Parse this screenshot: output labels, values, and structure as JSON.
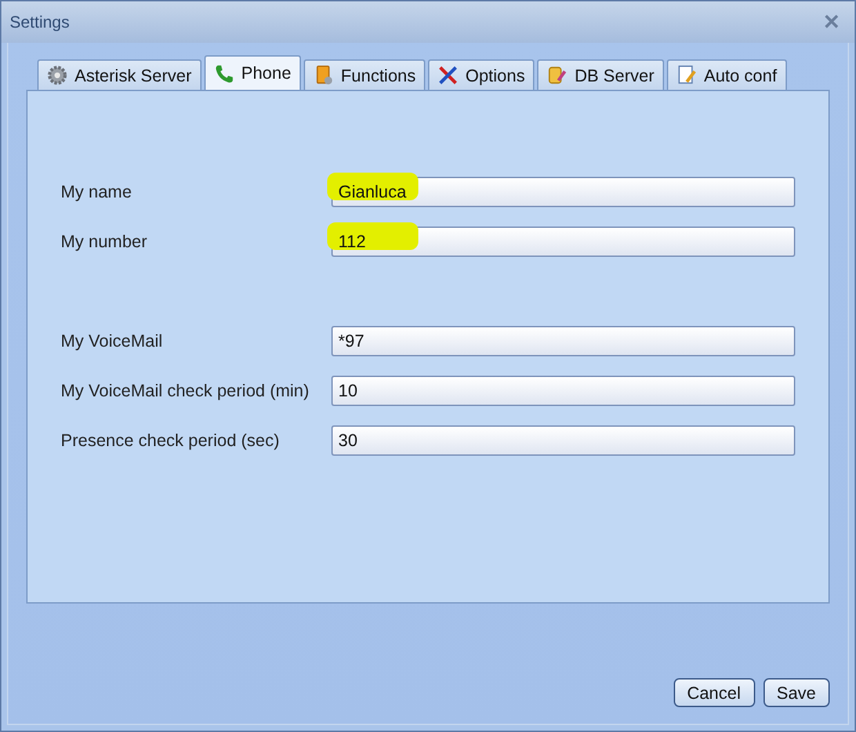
{
  "window": {
    "title": "Settings",
    "close": "✕"
  },
  "tabs": [
    {
      "label": "Asterisk Server",
      "selected": false
    },
    {
      "label": "Phone",
      "selected": true
    },
    {
      "label": "Functions",
      "selected": false
    },
    {
      "label": "Options",
      "selected": false
    },
    {
      "label": "DB Server",
      "selected": false
    },
    {
      "label": "Auto conf",
      "selected": false
    }
  ],
  "field_groups": [
    [
      {
        "label": "My name",
        "value": "Gianluca",
        "highlighted": true
      },
      {
        "label": "My number",
        "value": "112",
        "highlighted": true
      }
    ],
    [
      {
        "label": "My VoiceMail",
        "value": "*97",
        "highlighted": false
      },
      {
        "label": "My VoiceMail check period (min)",
        "value": "10",
        "highlighted": false
      },
      {
        "label": "Presence check period (sec)",
        "value": "30",
        "highlighted": false
      }
    ]
  ],
  "buttons": [
    "Cancel",
    "Save"
  ]
}
